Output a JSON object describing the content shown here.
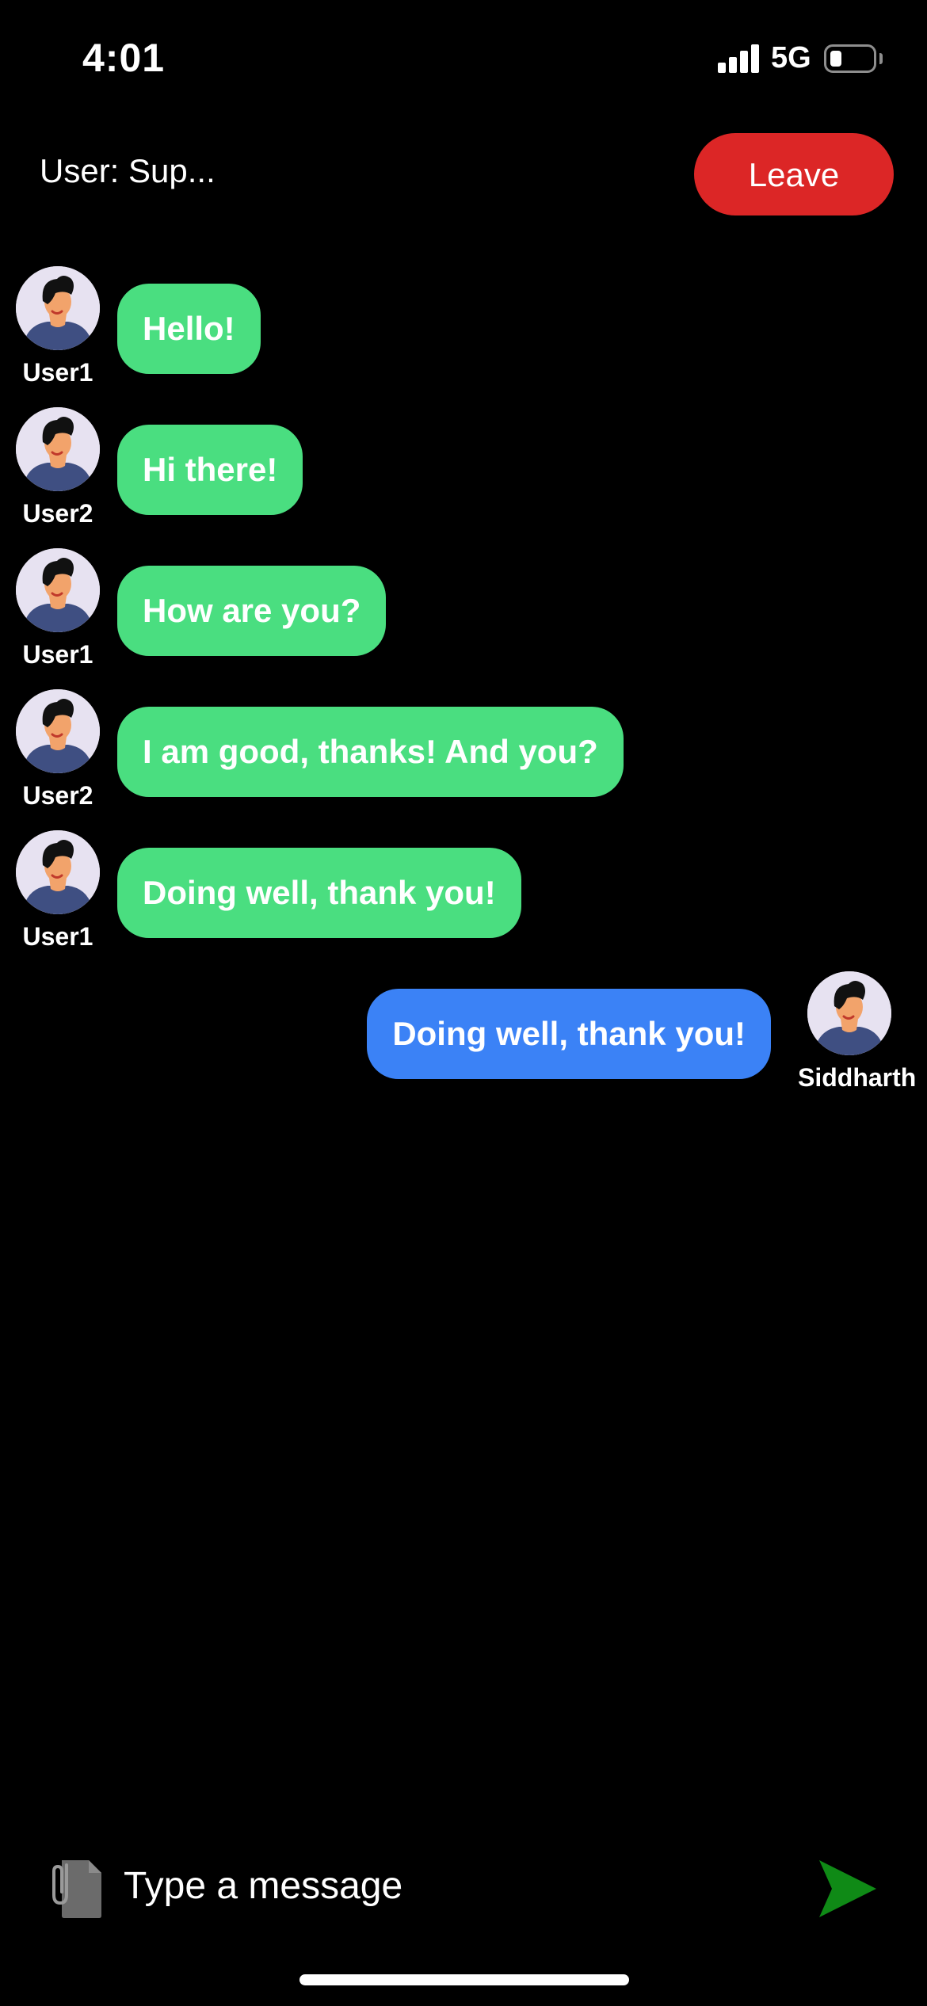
{
  "status_bar": {
    "time": "4:01",
    "network": "5G",
    "signal_bars": 4,
    "battery_level": 0.28
  },
  "header": {
    "title": "User: Sup...",
    "leave_label": "Leave"
  },
  "messages": [
    {
      "sender": "User1",
      "text": "Hello!",
      "direction": "incoming"
    },
    {
      "sender": "User2",
      "text": "Hi there!",
      "direction": "incoming"
    },
    {
      "sender": "User1",
      "text": "How are you?",
      "direction": "incoming"
    },
    {
      "sender": "User2",
      "text": "I am good, thanks! And you?",
      "direction": "incoming"
    },
    {
      "sender": "User1",
      "text": "Doing well, thank you!",
      "direction": "incoming"
    },
    {
      "sender": "Siddharth",
      "text": "Doing well, thank you!",
      "direction": "outgoing"
    }
  ],
  "composer": {
    "placeholder": "Type a message",
    "attach_icon": "attach-file-icon",
    "send_icon": "send-arrow-icon"
  },
  "colors": {
    "background": "#000000",
    "incoming_bubble": "#4ade80",
    "outgoing_bubble": "#3b82f6",
    "leave_button": "#dc2626",
    "send_icon": "#0f8a16"
  }
}
